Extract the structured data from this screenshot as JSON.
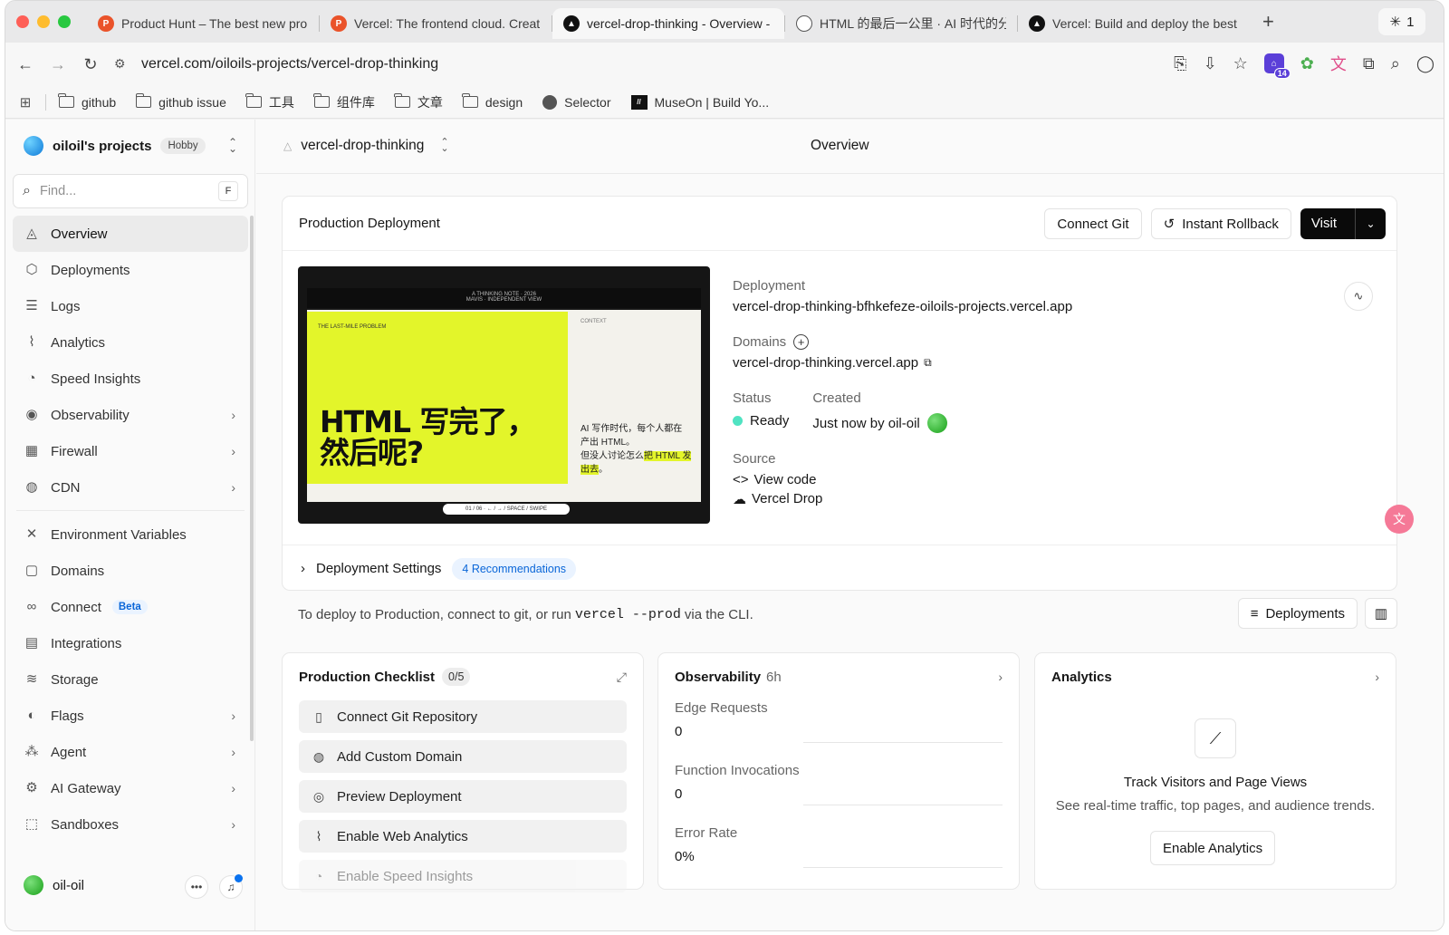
{
  "browser": {
    "tabs": [
      {
        "label": "Product Hunt – The best new pro",
        "icon": "product-hunt-icon",
        "fav": "P",
        "active": false
      },
      {
        "label": "Vercel: The frontend cloud. Creat",
        "icon": "product-hunt-icon",
        "fav": "P",
        "active": false
      },
      {
        "label": "vercel-drop-thinking - Overview -",
        "icon": "vercel-icon",
        "fav": "▲",
        "active": true
      },
      {
        "label": "HTML 的最后一公里 · AI 时代的分",
        "icon": "globe-icon",
        "fav": "",
        "active": false
      },
      {
        "label": "Vercel: Build and deploy the best",
        "icon": "vercel-icon",
        "fav": "▲",
        "active": false
      }
    ],
    "tab_count": "1",
    "url": "vercel.com/oiloils-projects/vercel-drop-thinking",
    "extension_badge": "14",
    "bookmarks": [
      {
        "label": "github",
        "icon": "folder-icon"
      },
      {
        "label": "github issue",
        "icon": "folder-icon"
      },
      {
        "label": "工具",
        "icon": "folder-icon"
      },
      {
        "label": "组件库",
        "icon": "folder-icon"
      },
      {
        "label": "文章",
        "icon": "folder-icon"
      },
      {
        "label": "design",
        "icon": "folder-icon"
      },
      {
        "label": "Selector",
        "icon": "globe-icon"
      },
      {
        "label": "MuseOn | Build Yo...",
        "icon": "museon-icon"
      }
    ]
  },
  "sidebar": {
    "team": "oiloil's projects",
    "plan": "Hobby",
    "find_placeholder": "Find...",
    "find_shortcut": "F",
    "items": [
      {
        "label": "Overview",
        "icon": "overview-icon",
        "glyph": "◬",
        "active": true,
        "chevron": false
      },
      {
        "label": "Deployments",
        "icon": "deployments-icon",
        "glyph": "⬡",
        "chevron": false
      },
      {
        "label": "Logs",
        "icon": "logs-icon",
        "glyph": "☰",
        "chevron": false
      },
      {
        "label": "Analytics",
        "icon": "analytics-icon",
        "glyph": "⌇",
        "chevron": false
      },
      {
        "label": "Speed Insights",
        "icon": "speed-insights-icon",
        "glyph": "◔",
        "chevron": false
      },
      {
        "label": "Observability",
        "icon": "observability-icon",
        "glyph": "◉",
        "chevron": true
      },
      {
        "label": "Firewall",
        "icon": "firewall-icon",
        "glyph": "▦",
        "chevron": true
      },
      {
        "label": "CDN",
        "icon": "cdn-icon",
        "glyph": "◍",
        "chevron": true
      }
    ],
    "items2": [
      {
        "label": "Environment Variables",
        "icon": "environment-variables-icon",
        "glyph": "✕"
      },
      {
        "label": "Domains",
        "icon": "domains-icon",
        "glyph": "▢"
      },
      {
        "label": "Connect",
        "icon": "connect-icon",
        "glyph": "∞",
        "badge": "Beta"
      },
      {
        "label": "Integrations",
        "icon": "integrations-icon",
        "glyph": "▤"
      },
      {
        "label": "Storage",
        "icon": "storage-icon",
        "glyph": "≋"
      },
      {
        "label": "Flags",
        "icon": "flags-icon",
        "glyph": "◐",
        "chevron": true
      },
      {
        "label": "Agent",
        "icon": "agent-icon",
        "glyph": "⁂",
        "chevron": true
      },
      {
        "label": "AI Gateway",
        "icon": "ai-gateway-icon",
        "glyph": "⚙",
        "chevron": true
      },
      {
        "label": "Sandboxes",
        "icon": "sandboxes-icon",
        "glyph": "⬚",
        "chevron": true
      }
    ],
    "user": "oil-oil"
  },
  "main": {
    "project": "vercel-drop-thinking",
    "page_title": "Overview",
    "production": {
      "heading": "Production Deployment",
      "connect_git": "Connect Git",
      "rollback": "Instant Rollback",
      "visit": "Visit",
      "deployment_label": "Deployment",
      "deployment_url": "vercel-drop-thinking-bfhkefeze-oiloils-projects.vercel.app",
      "domains_label": "Domains",
      "domain": "vercel-drop-thinking.vercel.app",
      "status_label": "Status",
      "status": "Ready",
      "status_color": "#50e3c2",
      "created_label": "Created",
      "created": "Just now by oil-oil",
      "source_label": "Source",
      "view_code": "View code",
      "vercel_drop": "Vercel Drop",
      "settings": "Deployment Settings",
      "recommendations": "4 Recommendations",
      "preview": {
        "top": "A THINKING NOTE · 2026",
        "top2": "MAVIS · INDEPENDENT VIEW",
        "small": "THE LAST-MILE PROBLEM",
        "headline1": "HTML 写完了，",
        "headline2": "然后呢?",
        "context": "CONTEXT",
        "side1": "AI 写作时代，每个人都在",
        "side2": "产出 HTML。",
        "side3": "但没人讨论怎么",
        "side_hl": "把 HTML 发出去",
        "side4": "。",
        "footer": "01 / 06 · ← / → / SPACE / SWIPE"
      }
    },
    "cli": {
      "before": "To deploy to Production, connect to git, or run",
      "command": "vercel --prod",
      "after": "via the CLI.",
      "deployments": "Deployments"
    },
    "checklist": {
      "title": "Production Checklist",
      "count": "0/5",
      "items": [
        {
          "label": "Connect Git Repository",
          "icon": "git-repo-icon",
          "glyph": "▯"
        },
        {
          "label": "Add Custom Domain",
          "icon": "globe-icon",
          "glyph": "◍"
        },
        {
          "label": "Preview Deployment",
          "icon": "preview-icon",
          "glyph": "◎"
        },
        {
          "label": "Enable Web Analytics",
          "icon": "analytics-icon",
          "glyph": "⌇"
        },
        {
          "label": "Enable Speed Insights",
          "icon": "speed-insights-icon",
          "glyph": "◔"
        }
      ]
    },
    "observability": {
      "title": "Observability",
      "range": "6h",
      "metrics": [
        {
          "label": "Edge Requests",
          "value": "0"
        },
        {
          "label": "Function Invocations",
          "value": "0"
        },
        {
          "label": "Error Rate",
          "value": "0%"
        }
      ]
    },
    "analytics": {
      "title": "Analytics",
      "heading": "Track Visitors and Page Views",
      "sub": "See real-time traffic, top pages, and audience trends.",
      "button": "Enable Analytics"
    }
  }
}
